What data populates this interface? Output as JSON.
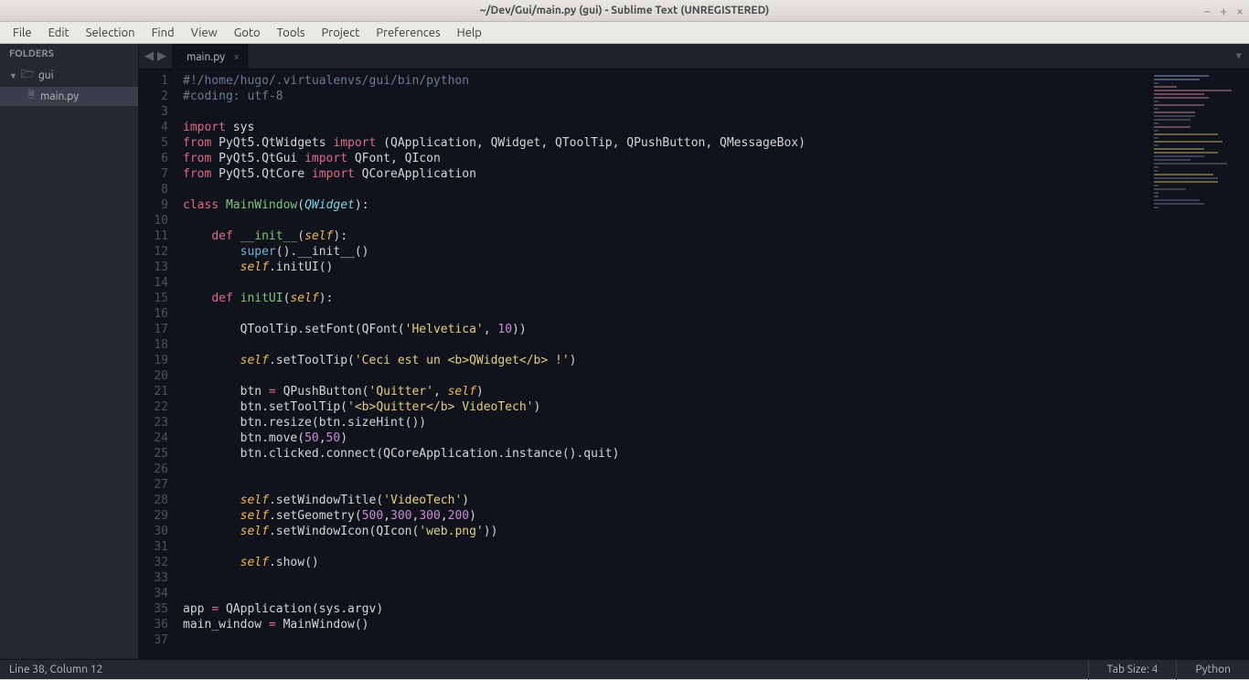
{
  "window": {
    "title": "~/Dev/Gui/main.py (gui) - Sublime Text (UNREGISTERED)"
  },
  "menubar": [
    "File",
    "Edit",
    "Selection",
    "Find",
    "View",
    "Goto",
    "Tools",
    "Project",
    "Preferences",
    "Help"
  ],
  "sidebar": {
    "header": "FOLDERS",
    "folder": {
      "name": "gui"
    },
    "files": [
      {
        "name": "main.py"
      }
    ]
  },
  "tabs": {
    "active": {
      "label": "main.py"
    }
  },
  "code": {
    "line_count": 37,
    "lines": [
      [
        {
          "t": "comment",
          "v": "#!/home/hugo/.virtualenvs/gui/bin/python"
        }
      ],
      [
        {
          "t": "comment",
          "v": "#coding: utf-8"
        }
      ],
      [],
      [
        {
          "t": "keyword",
          "v": "import"
        },
        {
          "t": "plain",
          "v": " "
        },
        {
          "t": "plain",
          "v": "sys"
        }
      ],
      [
        {
          "t": "keyword",
          "v": "from"
        },
        {
          "t": "plain",
          "v": " PyQt5.QtWidgets "
        },
        {
          "t": "keyword",
          "v": "import"
        },
        {
          "t": "plain",
          "v": " (QApplication, QWidget, QToolTip, QPushButton, QMessageBox)"
        }
      ],
      [
        {
          "t": "keyword",
          "v": "from"
        },
        {
          "t": "plain",
          "v": " PyQt5.QtGui "
        },
        {
          "t": "keyword",
          "v": "import"
        },
        {
          "t": "plain",
          "v": " QFont, QIcon"
        }
      ],
      [
        {
          "t": "keyword",
          "v": "from"
        },
        {
          "t": "plain",
          "v": " PyQt5.QtCore "
        },
        {
          "t": "keyword",
          "v": "import"
        },
        {
          "t": "plain",
          "v": " QCoreApplication"
        }
      ],
      [],
      [
        {
          "t": "keyword",
          "v": "class"
        },
        {
          "t": "plain",
          "v": " "
        },
        {
          "t": "classname",
          "v": "MainWindow"
        },
        {
          "t": "plain",
          "v": "("
        },
        {
          "t": "class-it",
          "v": "QWidget"
        },
        {
          "t": "plain",
          "v": "):"
        }
      ],
      [],
      [
        {
          "t": "plain",
          "v": "    "
        },
        {
          "t": "keyword",
          "v": "def"
        },
        {
          "t": "plain",
          "v": " "
        },
        {
          "t": "funcname",
          "v": "__init__"
        },
        {
          "t": "plain",
          "v": "("
        },
        {
          "t": "param",
          "v": "self"
        },
        {
          "t": "plain",
          "v": "):"
        }
      ],
      [
        {
          "t": "plain",
          "v": "        "
        },
        {
          "t": "builtin",
          "v": "super"
        },
        {
          "t": "plain",
          "v": "().__init__()"
        }
      ],
      [
        {
          "t": "plain",
          "v": "        "
        },
        {
          "t": "param",
          "v": "self"
        },
        {
          "t": "plain",
          "v": ".initUI()"
        }
      ],
      [],
      [
        {
          "t": "plain",
          "v": "    "
        },
        {
          "t": "keyword",
          "v": "def"
        },
        {
          "t": "plain",
          "v": " "
        },
        {
          "t": "funcname",
          "v": "initUI"
        },
        {
          "t": "plain",
          "v": "("
        },
        {
          "t": "param",
          "v": "self"
        },
        {
          "t": "plain",
          "v": "):"
        }
      ],
      [],
      [
        {
          "t": "plain",
          "v": "        QToolTip.setFont(QFont("
        },
        {
          "t": "string",
          "v": "'Helvetica'"
        },
        {
          "t": "plain",
          "v": ", "
        },
        {
          "t": "number",
          "v": "10"
        },
        {
          "t": "plain",
          "v": "))"
        }
      ],
      [],
      [
        {
          "t": "plain",
          "v": "        "
        },
        {
          "t": "param",
          "v": "self"
        },
        {
          "t": "plain",
          "v": ".setToolTip("
        },
        {
          "t": "string",
          "v": "'Ceci est un <b>QWidget</b> !'"
        },
        {
          "t": "plain",
          "v": ")"
        }
      ],
      [],
      [
        {
          "t": "plain",
          "v": "        btn "
        },
        {
          "t": "op",
          "v": "="
        },
        {
          "t": "plain",
          "v": " QPushButton("
        },
        {
          "t": "string",
          "v": "'Quitter'"
        },
        {
          "t": "plain",
          "v": ", "
        },
        {
          "t": "param",
          "v": "self"
        },
        {
          "t": "plain",
          "v": ")"
        }
      ],
      [
        {
          "t": "plain",
          "v": "        btn.setToolTip("
        },
        {
          "t": "string",
          "v": "'<b>Quitter</b> VideoTech'"
        },
        {
          "t": "plain",
          "v": ")"
        }
      ],
      [
        {
          "t": "plain",
          "v": "        btn.resize(btn.sizeHint())"
        }
      ],
      [
        {
          "t": "plain",
          "v": "        btn.move("
        },
        {
          "t": "number",
          "v": "50"
        },
        {
          "t": "plain",
          "v": ","
        },
        {
          "t": "number",
          "v": "50"
        },
        {
          "t": "plain",
          "v": ")"
        }
      ],
      [
        {
          "t": "plain",
          "v": "        btn.clicked.connect(QCoreApplication.instance().quit)"
        }
      ],
      [],
      [],
      [
        {
          "t": "plain",
          "v": "        "
        },
        {
          "t": "param",
          "v": "self"
        },
        {
          "t": "plain",
          "v": ".setWindowTitle("
        },
        {
          "t": "string",
          "v": "'VideoTech'"
        },
        {
          "t": "plain",
          "v": ")"
        }
      ],
      [
        {
          "t": "plain",
          "v": "        "
        },
        {
          "t": "param",
          "v": "self"
        },
        {
          "t": "plain",
          "v": ".setGeometry("
        },
        {
          "t": "number",
          "v": "500"
        },
        {
          "t": "plain",
          "v": ","
        },
        {
          "t": "number",
          "v": "300"
        },
        {
          "t": "plain",
          "v": ","
        },
        {
          "t": "number",
          "v": "300"
        },
        {
          "t": "plain",
          "v": ","
        },
        {
          "t": "number",
          "v": "200"
        },
        {
          "t": "plain",
          "v": ")"
        }
      ],
      [
        {
          "t": "plain",
          "v": "        "
        },
        {
          "t": "param",
          "v": "self"
        },
        {
          "t": "plain",
          "v": ".setWindowIcon(QIcon("
        },
        {
          "t": "string",
          "v": "'web.png'"
        },
        {
          "t": "plain",
          "v": "))"
        }
      ],
      [],
      [
        {
          "t": "plain",
          "v": "        "
        },
        {
          "t": "param",
          "v": "self"
        },
        {
          "t": "plain",
          "v": ".show()"
        }
      ],
      [],
      [],
      [
        {
          "t": "plain",
          "v": "app "
        },
        {
          "t": "op",
          "v": "="
        },
        {
          "t": "plain",
          "v": " QApplication(sys.argv)"
        }
      ],
      [
        {
          "t": "plain",
          "v": "main_window "
        },
        {
          "t": "op",
          "v": "="
        },
        {
          "t": "plain",
          "v": " MainWindow()"
        }
      ],
      []
    ]
  },
  "statusbar": {
    "position": "Line 38, Column 12",
    "tab_size": "Tab Size: 4",
    "syntax": "Python"
  }
}
